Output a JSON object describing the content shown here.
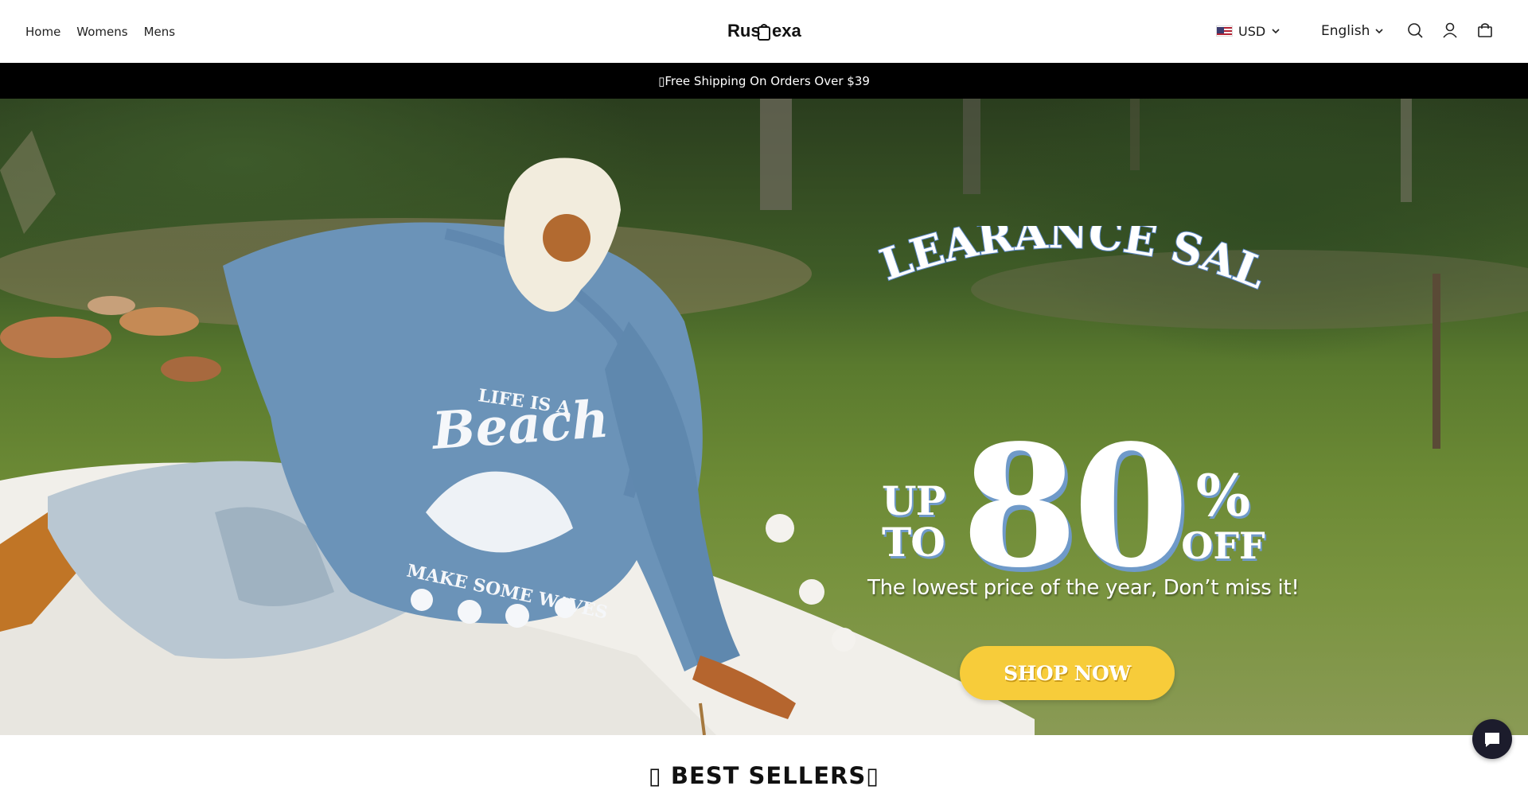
{
  "header": {
    "nav": [
      {
        "label": "Home"
      },
      {
        "label": "Womens"
      },
      {
        "label": "Mens"
      }
    ],
    "logo_text": "Rus​exa",
    "currency": "USD",
    "language": "English",
    "icons": [
      "search-icon",
      "account-icon",
      "cart-icon"
    ]
  },
  "announcement": {
    "text": "▯Free Shipping On Orders Over $39"
  },
  "hero": {
    "headline": "CLEARANCE SALE",
    "up_to_line1": "UP",
    "up_to_line2": "TO",
    "discount_number": "80",
    "percent": "%",
    "off": "OFF",
    "tagline": "The lowest price of the year, Don’t miss it!",
    "cta": "SHOP NOW",
    "sweatshirt_text": {
      "line1": "LIFE IS A",
      "line2": "Beach",
      "line3": "MAKE SOME WAVES"
    }
  },
  "best_sellers": {
    "title": "▯ BEST SELLERS▯"
  },
  "colors": {
    "announcement_bg": "#000000",
    "cta_bg": "#f7cc3a",
    "sweatshirt": "#6b93b8",
    "chat_bg": "#1c1c2c"
  }
}
